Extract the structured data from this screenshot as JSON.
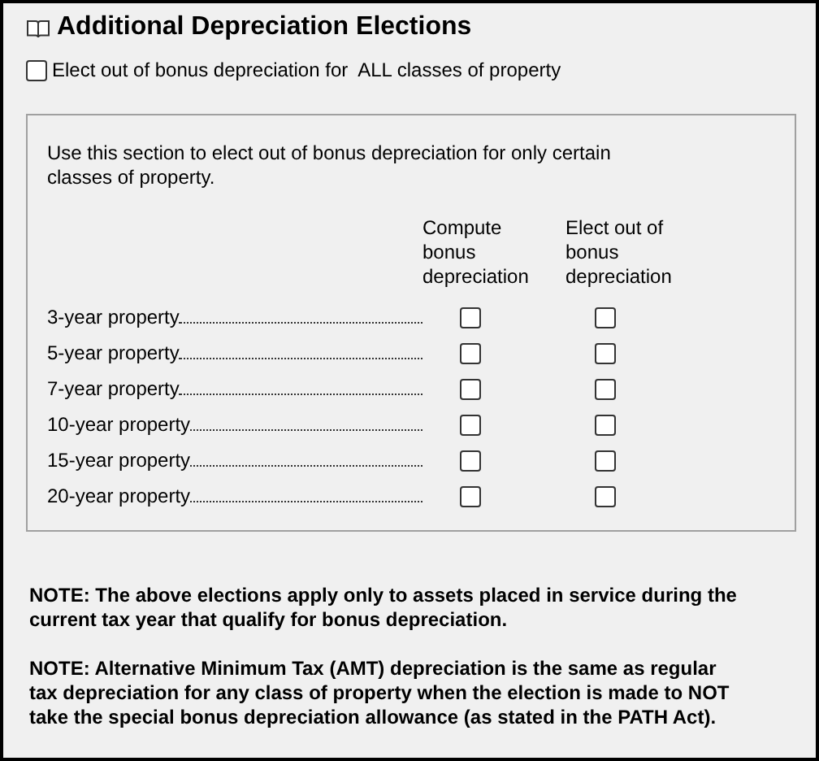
{
  "title": "Additional Depreciation Elections",
  "elect_all": {
    "label": "Elect out of bonus depreciation for  ALL classes of property",
    "checked": false
  },
  "section": {
    "intro": "Use this section to elect out of bonus depreciation for only certain classes of property.",
    "columns": [
      "Compute bonus depreciation",
      "Elect out of bonus depreciation"
    ],
    "rows": [
      {
        "label": "3-year property",
        "compute": false,
        "elect_out": false
      },
      {
        "label": "5-year property",
        "compute": false,
        "elect_out": false
      },
      {
        "label": "7-year property",
        "compute": false,
        "elect_out": false
      },
      {
        "label": "10-year property",
        "compute": false,
        "elect_out": false
      },
      {
        "label": "15-year property",
        "compute": false,
        "elect_out": false
      },
      {
        "label": "20-year property",
        "compute": false,
        "elect_out": false
      }
    ]
  },
  "notes": [
    "NOTE: The above elections apply only to assets placed in service during the current tax year that qualify for bonus depreciation.",
    "NOTE: Alternative Minimum Tax (AMT) depreciation is the same as regular tax depreciation for any class of property when the election is made to NOT take the special bonus depreciation allowance (as stated in the PATH Act)."
  ]
}
